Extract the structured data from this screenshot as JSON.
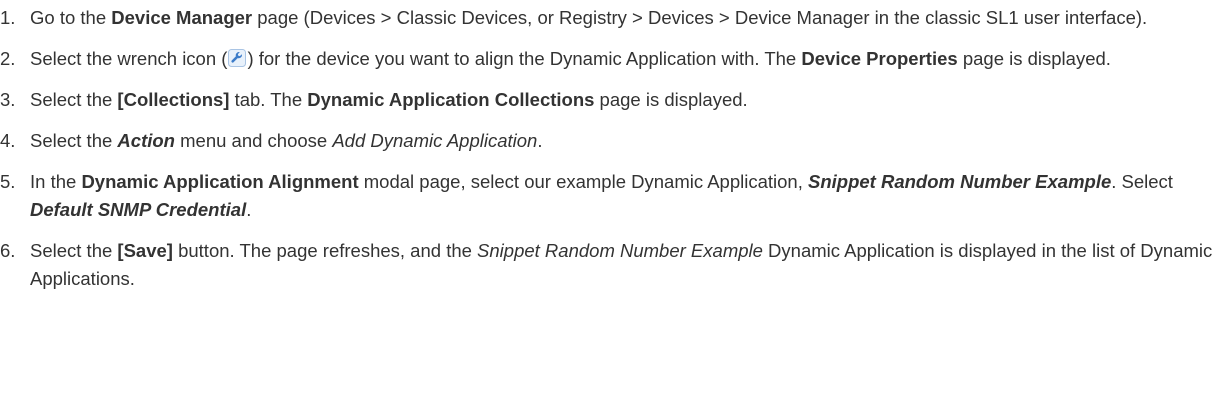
{
  "steps": [
    {
      "number": "1.",
      "segments": [
        {
          "text": "Go to the "
        },
        {
          "text": "Device Manager",
          "style": "b"
        },
        {
          "text": " page (Devices > Classic Devices, or Registry > Devices > Device Manager in the classic SL1 user interface)."
        }
      ]
    },
    {
      "number": "2.",
      "segments": [
        {
          "text": "Select the wrench icon ("
        },
        {
          "icon": "wrench-icon"
        },
        {
          "text": ") for the device you want to align the Dynamic Application with. The "
        },
        {
          "text": "Device Properties",
          "style": "b"
        },
        {
          "text": " page is displayed."
        }
      ]
    },
    {
      "number": "3.",
      "segments": [
        {
          "text": "Select the "
        },
        {
          "text": "[Collections]",
          "style": "b"
        },
        {
          "text": " tab. The "
        },
        {
          "text": "Dynamic Application Collections",
          "style": "b"
        },
        {
          "text": " page is displayed."
        }
      ]
    },
    {
      "number": "4.",
      "segments": [
        {
          "text": "Select the "
        },
        {
          "text": "Action",
          "style": "bi"
        },
        {
          "text": " menu and choose "
        },
        {
          "text": "Add Dynamic Application",
          "style": "i"
        },
        {
          "text": "."
        }
      ]
    },
    {
      "number": "5.",
      "segments": [
        {
          "text": "In the "
        },
        {
          "text": "Dynamic Application Alignment",
          "style": "b"
        },
        {
          "text": " modal page, select our example Dynamic Application, "
        },
        {
          "text": "Snippet Random Number Example",
          "style": "bi"
        },
        {
          "text": ". Select "
        },
        {
          "text": "Default SNMP Credential",
          "style": "bi"
        },
        {
          "text": "."
        }
      ]
    },
    {
      "number": "6.",
      "segments": [
        {
          "text": "Select the "
        },
        {
          "text": "[Save]",
          "style": "b"
        },
        {
          "text": " button. The page refreshes, and the "
        },
        {
          "text": "Snippet Random Number Example",
          "style": "i"
        },
        {
          "text": "  Dynamic Application is displayed in the list of Dynamic Applications."
        }
      ]
    }
  ]
}
